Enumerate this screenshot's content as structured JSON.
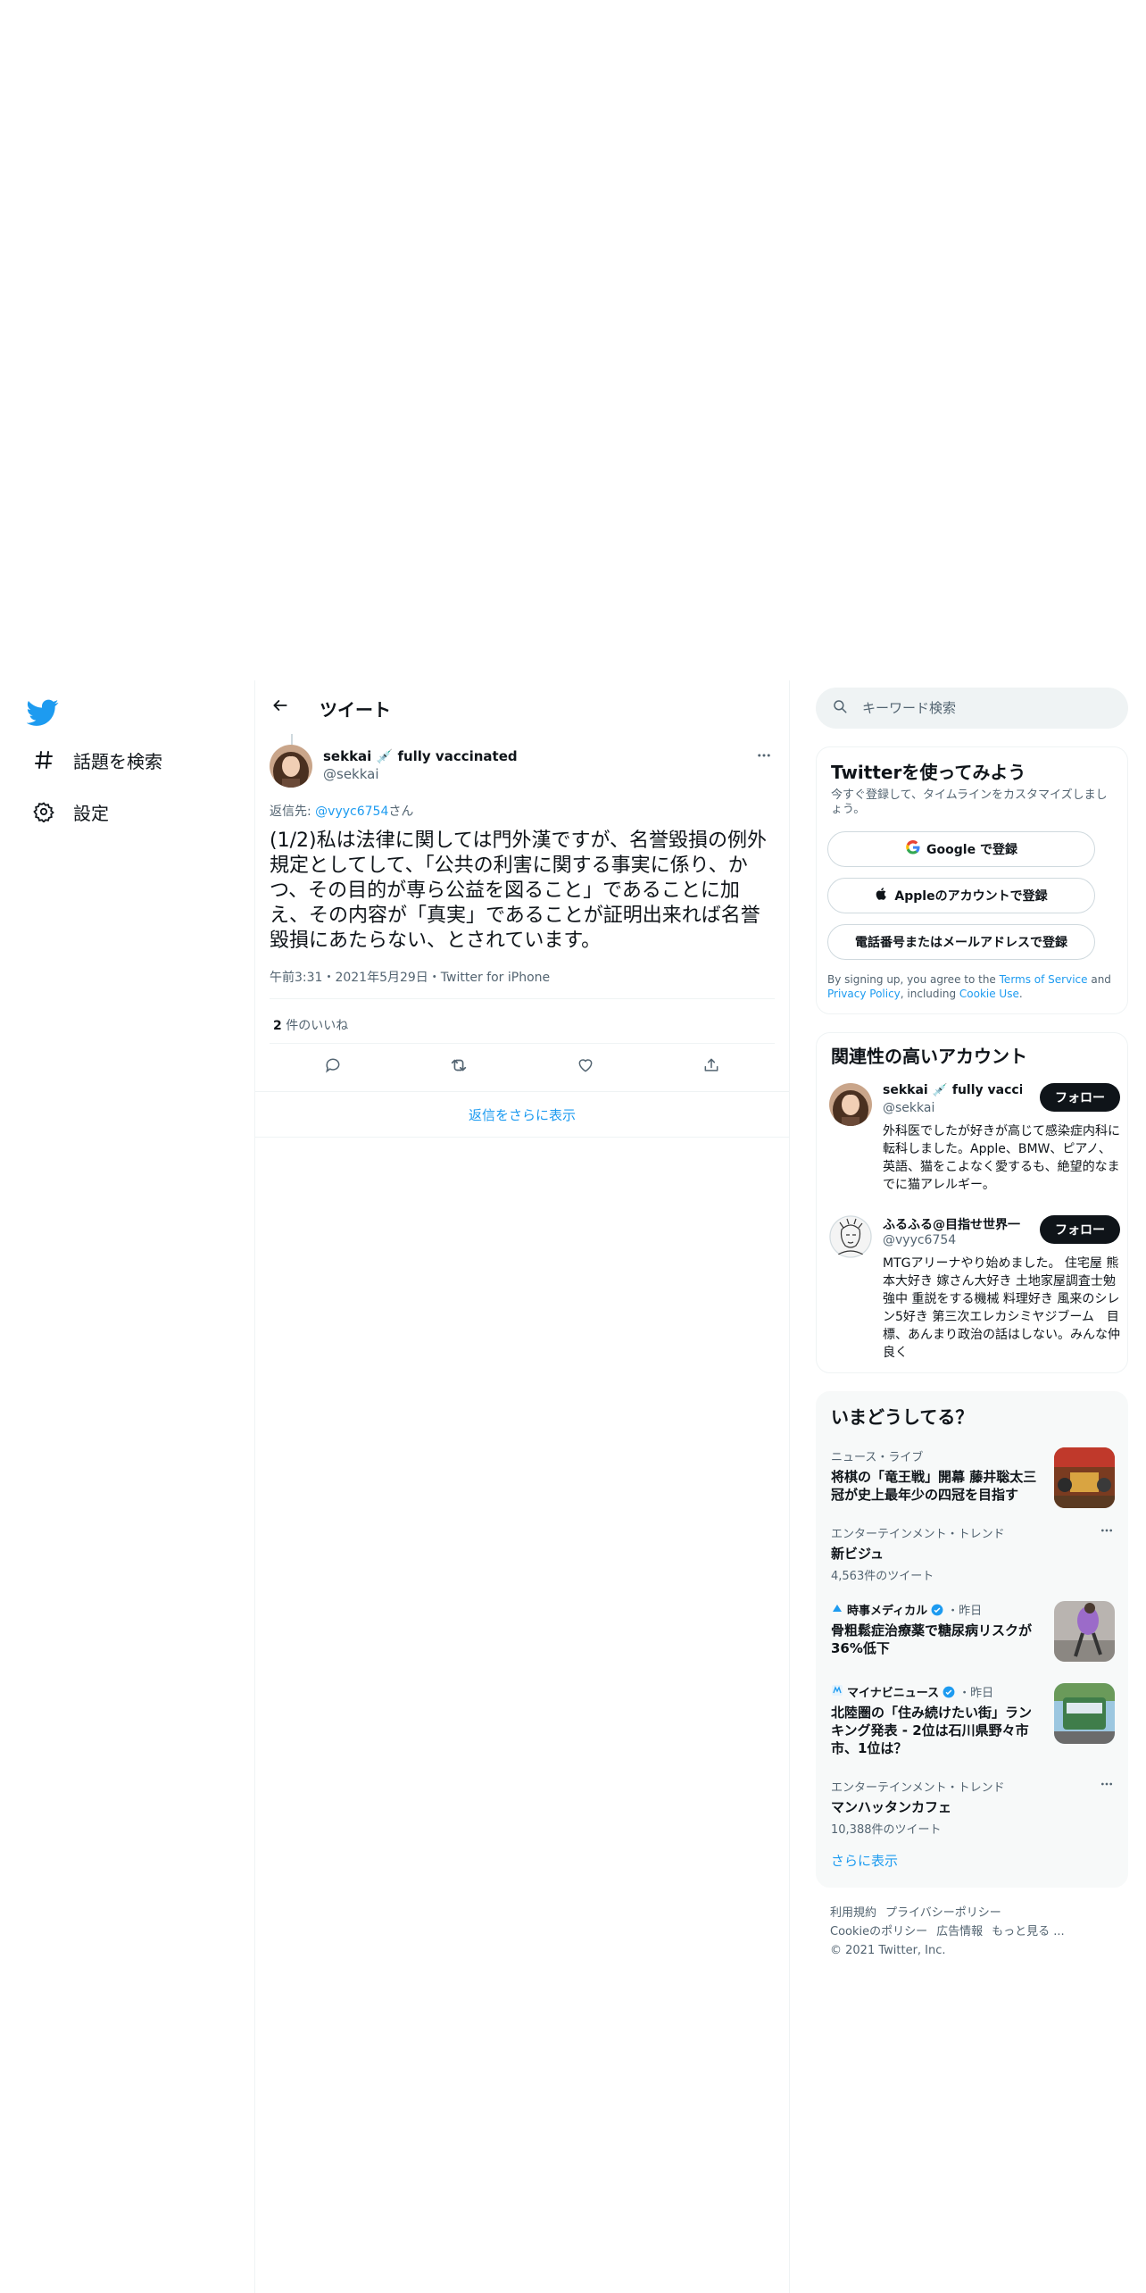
{
  "nav": {
    "items": [
      {
        "label": "話題を検索",
        "icon": "hashtag-icon"
      },
      {
        "label": "設定",
        "icon": "gear-icon"
      }
    ]
  },
  "main": {
    "title": "ツイート",
    "tweet": {
      "author_name": "sekkai 💉 fully vaccinated",
      "author_handle": "@sekkai",
      "reply_prefix": "返信先: ",
      "reply_to": "@vyyc6754",
      "reply_suffix": "さん",
      "text": "(1/2)私は法律に関しては門外漢ですが、名誉毀損の例外規定としてして、「公共の利害に関する事実に係り、かつ、その目的が専ら公益を図ること」であることに加え、その内容が「真実」であることが証明出来れば名誉毀損にあたらない、とされています。",
      "meta": "午前3:31・2021年5月29日・Twitter for iPhone",
      "likes_count": "2",
      "likes_label": " 件のいいね"
    },
    "show_more_replies": "返信をさらに表示"
  },
  "search": {
    "placeholder": "キーワード検索"
  },
  "signup": {
    "title": "Twitterを使ってみよう",
    "subtitle": "今すぐ登録して、タイムラインをカスタマイズしましょう。",
    "google_label": "Google で登録",
    "apple_label": "Appleのアカウントで登録",
    "phone_label": "電話番号またはメールアドレスで登録",
    "legal_prefix": "By signing up, you agree to the ",
    "terms_link": "Terms of Service",
    "legal_mid": " and ",
    "privacy_link": "Privacy Policy",
    "legal_mid2": ", including ",
    "cookie_link": "Cookie Use",
    "legal_end": "."
  },
  "related": {
    "title": "関連性の高いアカウント",
    "follow_label": "フォロー",
    "accounts": [
      {
        "name": "sekkai 💉 fully vaccinated",
        "handle": "@sekkai",
        "bio": "外科医でしたが好きが高じて感染症内科に転科しました。Apple、BMW、ピアノ、英語、猫をこよなく愛するも、絶望的なまでに猫アレルギー。"
      },
      {
        "name": "ふるふる@目指せ世界一",
        "handle": "@vyyc6754",
        "bio": "MTGアリーナやり始めました。 住宅屋 熊本大好き 嫁さん大好き 土地家屋調査士勉強中 重説をする機械 料理好き 風来のシレン5好き 第三次エレカシミヤジブーム　目標、あんまり政治の話はしない。みんな仲良く"
      }
    ]
  },
  "trends": {
    "title": "いまどうしてる？",
    "items": [
      {
        "category": "ニュース・ライブ",
        "title": "将棋の「竜王戦」開幕 藤井聡太三冠が史上最年少の四冠を目指す",
        "count": ""
      },
      {
        "category": "エンターテインメント・トレンド",
        "title": "新ビジュ",
        "count": "4,563件のツイート"
      },
      {
        "category": "時事メディカル",
        "category_suffix": "・昨日",
        "title": "骨粗鬆症治療薬で糖尿病リスクが36%低下",
        "count": ""
      },
      {
        "category": "マイナビニュース",
        "category_suffix": "・昨日",
        "title": "北陸圏の「住み続けたい街」ランキング発表 - 2位は石川県野々市市、1位は？",
        "count": ""
      },
      {
        "category": "エンターテインメント・トレンド",
        "title": "マンハッタンカフェ",
        "count": "10,388件のツイート"
      }
    ],
    "show_more": "さらに表示"
  },
  "footer": {
    "links": [
      "利用規約",
      "プライバシーポリシー",
      "Cookieのポリシー",
      "広告情報",
      "もっと見る ..."
    ],
    "copyright": "© 2021 Twitter, Inc."
  },
  "colors": {
    "accent": "#1d9bf0",
    "text": "#0f1419",
    "secondary": "#536471",
    "border": "#eff3f4",
    "button_dark": "#0f1419"
  }
}
